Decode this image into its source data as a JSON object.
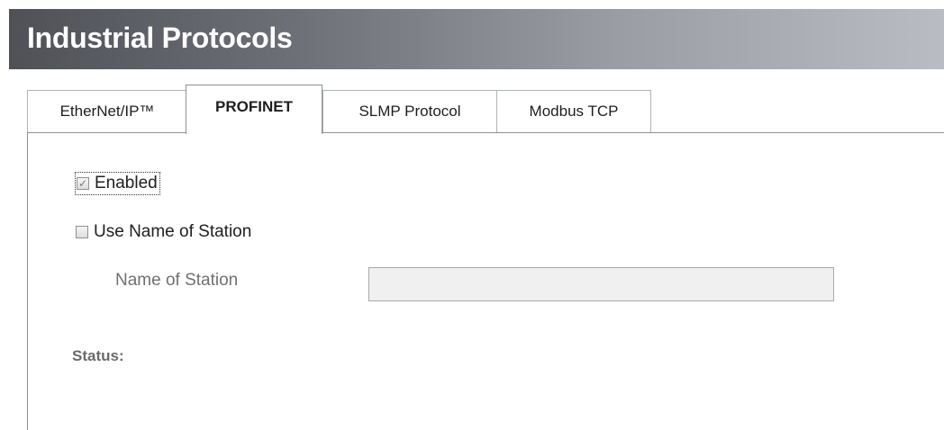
{
  "window": {
    "title": "Industrial Protocols"
  },
  "tabs": [
    {
      "label": "EtherNet/IP™",
      "active": false
    },
    {
      "label": "PROFINET",
      "active": true
    },
    {
      "label": "SLMP Protocol",
      "active": false
    },
    {
      "label": "Modbus TCP",
      "active": false
    }
  ],
  "profinet": {
    "enabled": {
      "label": "Enabled",
      "checked": true,
      "check_glyph": "✓"
    },
    "use_name_of_station": {
      "label": "Use Name of Station",
      "checked": false
    },
    "name_of_station": {
      "label": "Name of Station",
      "value": "",
      "disabled": true
    },
    "status_label": "Status:"
  },
  "colors": {
    "title_gradient_start": "#4f5157",
    "title_gradient_end": "#b9bcc2",
    "title_text": "#ffffff",
    "disabled_text": "#707070"
  }
}
